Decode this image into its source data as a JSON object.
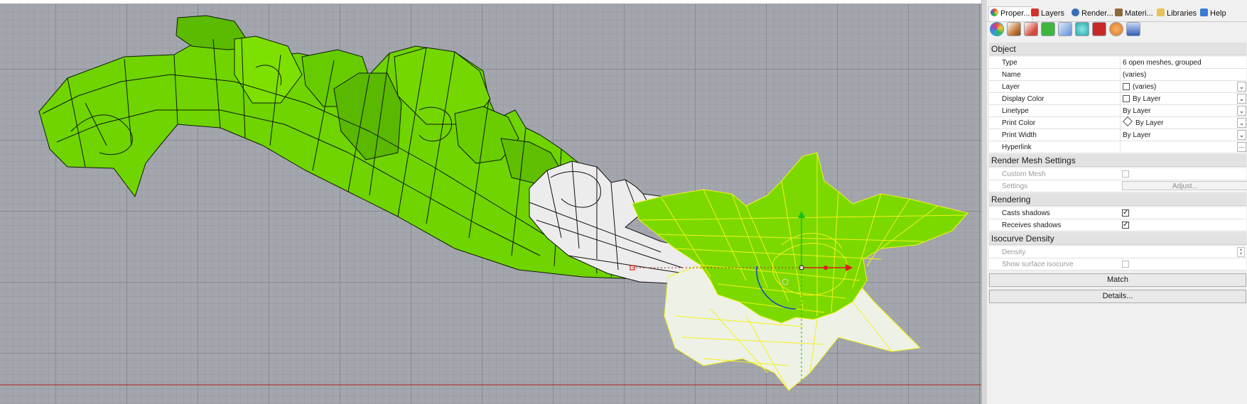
{
  "tabs": [
    {
      "label": "Proper...",
      "icon": "properties-icon",
      "color": "#e04b4b"
    },
    {
      "label": "Layers",
      "icon": "layers-icon",
      "color": "#d2322d"
    },
    {
      "label": "Render...",
      "icon": "rendering-icon",
      "color": "#3a6db5"
    },
    {
      "label": "Materi...",
      "icon": "materials-icon",
      "color": "#8c6a3a"
    },
    {
      "label": "Libraries",
      "icon": "folder-icon",
      "color": "#e8c25a"
    },
    {
      "label": "Help",
      "icon": "help-icon",
      "color": "#3a7bd5"
    }
  ],
  "icon_toolbar": [
    {
      "name": "object-properties-icon",
      "color": "#2aa3d8"
    },
    {
      "name": "material-brush-icon",
      "color": "#c77c3a"
    },
    {
      "name": "decal-icon",
      "color": "#d04a3a"
    },
    {
      "name": "texture-mapping-icon",
      "color": "#3fb43f"
    },
    {
      "name": "curve-piping-icon",
      "color": "#5d8fd8"
    },
    {
      "name": "displacement-icon",
      "color": "#28a8a8"
    },
    {
      "name": "edge-softening-icon",
      "color": "#c82828"
    },
    {
      "name": "shut-lining-icon",
      "color": "#e07b1e"
    },
    {
      "name": "thickness-icon",
      "color": "#2f5fb8"
    }
  ],
  "sections": {
    "object": "Object",
    "render_mesh": "Render Mesh Settings",
    "rendering": "Rendering",
    "isocurve": "Isocurve Density"
  },
  "object_rows": [
    {
      "label": "Type",
      "value": "6 open meshes, grouped"
    },
    {
      "label": "Name",
      "value": "(varies)"
    },
    {
      "label": "Layer",
      "value": "(varies)"
    },
    {
      "label": "Display Color",
      "value": "By Layer"
    },
    {
      "label": "Linetype",
      "value": "By Layer"
    },
    {
      "label": "Print Color",
      "value": "By Layer"
    },
    {
      "label": "Print Width",
      "value": "By Layer"
    },
    {
      "label": "Hyperlink",
      "value": ""
    }
  ],
  "hyperlink_button": "...",
  "render_mesh_rows": {
    "custom_mesh": "Custom Mesh",
    "settings": "Settings",
    "adjust_button": "Adjust..."
  },
  "rendering_rows": {
    "casts_shadows": "Casts shadows",
    "casts_shadows_checked": true,
    "receives_shadows": "Receives shadows",
    "receives_shadows_checked": true
  },
  "isocurve_rows": {
    "density": "Density",
    "show_surface_isocurve": "Show surface isocurve"
  },
  "buttons": {
    "match": "Match",
    "details": "Details..."
  },
  "check_mark": "✓",
  "dropdown_glyph": "⌄",
  "viewport": {
    "background": "#a3a6ac",
    "mesh_green": "#6fd400",
    "selection_yellow": "#f2f21a",
    "mesh_white": "#ececec"
  }
}
